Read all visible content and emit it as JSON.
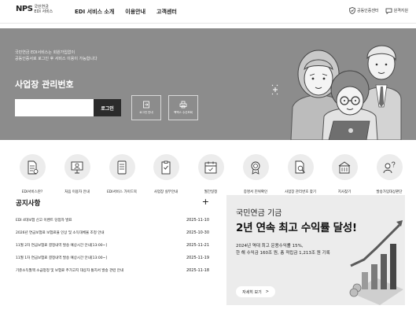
{
  "header": {
    "logo_mark": "NPS",
    "logo_line1": "국민연금",
    "logo_line2": "EDI 서비스",
    "nav": [
      "EDI 서비스 소개",
      "이용안내",
      "고객센터"
    ],
    "util": [
      {
        "icon": "shield-check-icon",
        "label": "공동인증센터"
      },
      {
        "icon": "chat-icon",
        "label": "원격지원"
      }
    ]
  },
  "hero": {
    "notice_line1": "국민연금 EDI서비스는 회원가입없이",
    "notice_line2": "공동인증서로 로그인 후 서비스 이용이 가능합니다",
    "title": "사업장 관리번호",
    "login_label": "로그인",
    "input_value": "",
    "tiles": [
      {
        "icon": "login-icon",
        "label": "로그인 안내"
      },
      {
        "icon": "printer-icon",
        "label": "팩맥스 수신조회"
      }
    ]
  },
  "quick_menu": [
    {
      "icon": "document-icon",
      "label": "EDI서비스란?"
    },
    {
      "icon": "user-guide-icon",
      "label": "처음 이용자 안내"
    },
    {
      "icon": "book-icon",
      "label": "EDI서비스 가이드북"
    },
    {
      "icon": "checklist-icon",
      "label": "사업장 실무안내"
    },
    {
      "icon": "calendar-icon",
      "label": "월간일정"
    },
    {
      "icon": "certificate-icon",
      "label": "증명서 진위확인"
    },
    {
      "icon": "search-document-icon",
      "label": "사업장 관리번호 찾기"
    },
    {
      "icon": "building-icon",
      "label": "지사찾기"
    },
    {
      "icon": "question-user-icon",
      "label": "발송가입대상판단"
    }
  ],
  "notices": {
    "title": "공지사항",
    "more": "+",
    "items": [
      {
        "title": "EDI 4대보험 신고 이벤트 당첨자 발표",
        "date": "2025-11-10"
      },
      {
        "title": "2026년 연금보험료 보험료율 인상 및 소득대체율 조정 안내",
        "date": "2025-10-30"
      },
      {
        "title": "11월 2차 연금보험료 결정내역 발송 예상시간 안내[13:00~]",
        "date": "2025-11-21"
      },
      {
        "title": "11월 1차 연금보험료 결정내역 발송 예상시간 안내[13:00~]",
        "date": "2025-11-19"
      },
      {
        "title": "기준소득월액 소급정정 및 보험료 추가고지 대상자 통지서 발송 관련 안내",
        "date": "2025-11-18"
      }
    ]
  },
  "banner": {
    "kicker": "국민연금 기금",
    "title": "2년 연속 최고 수익률 달성!",
    "desc_line1": "2024년 역대 최고 운용수익률 15%,",
    "desc_line2": "한 해 수익금 160조 원, 총 적립금 1,213조 원 기록",
    "button": "자세히 보기",
    "button_arrow": ">"
  }
}
